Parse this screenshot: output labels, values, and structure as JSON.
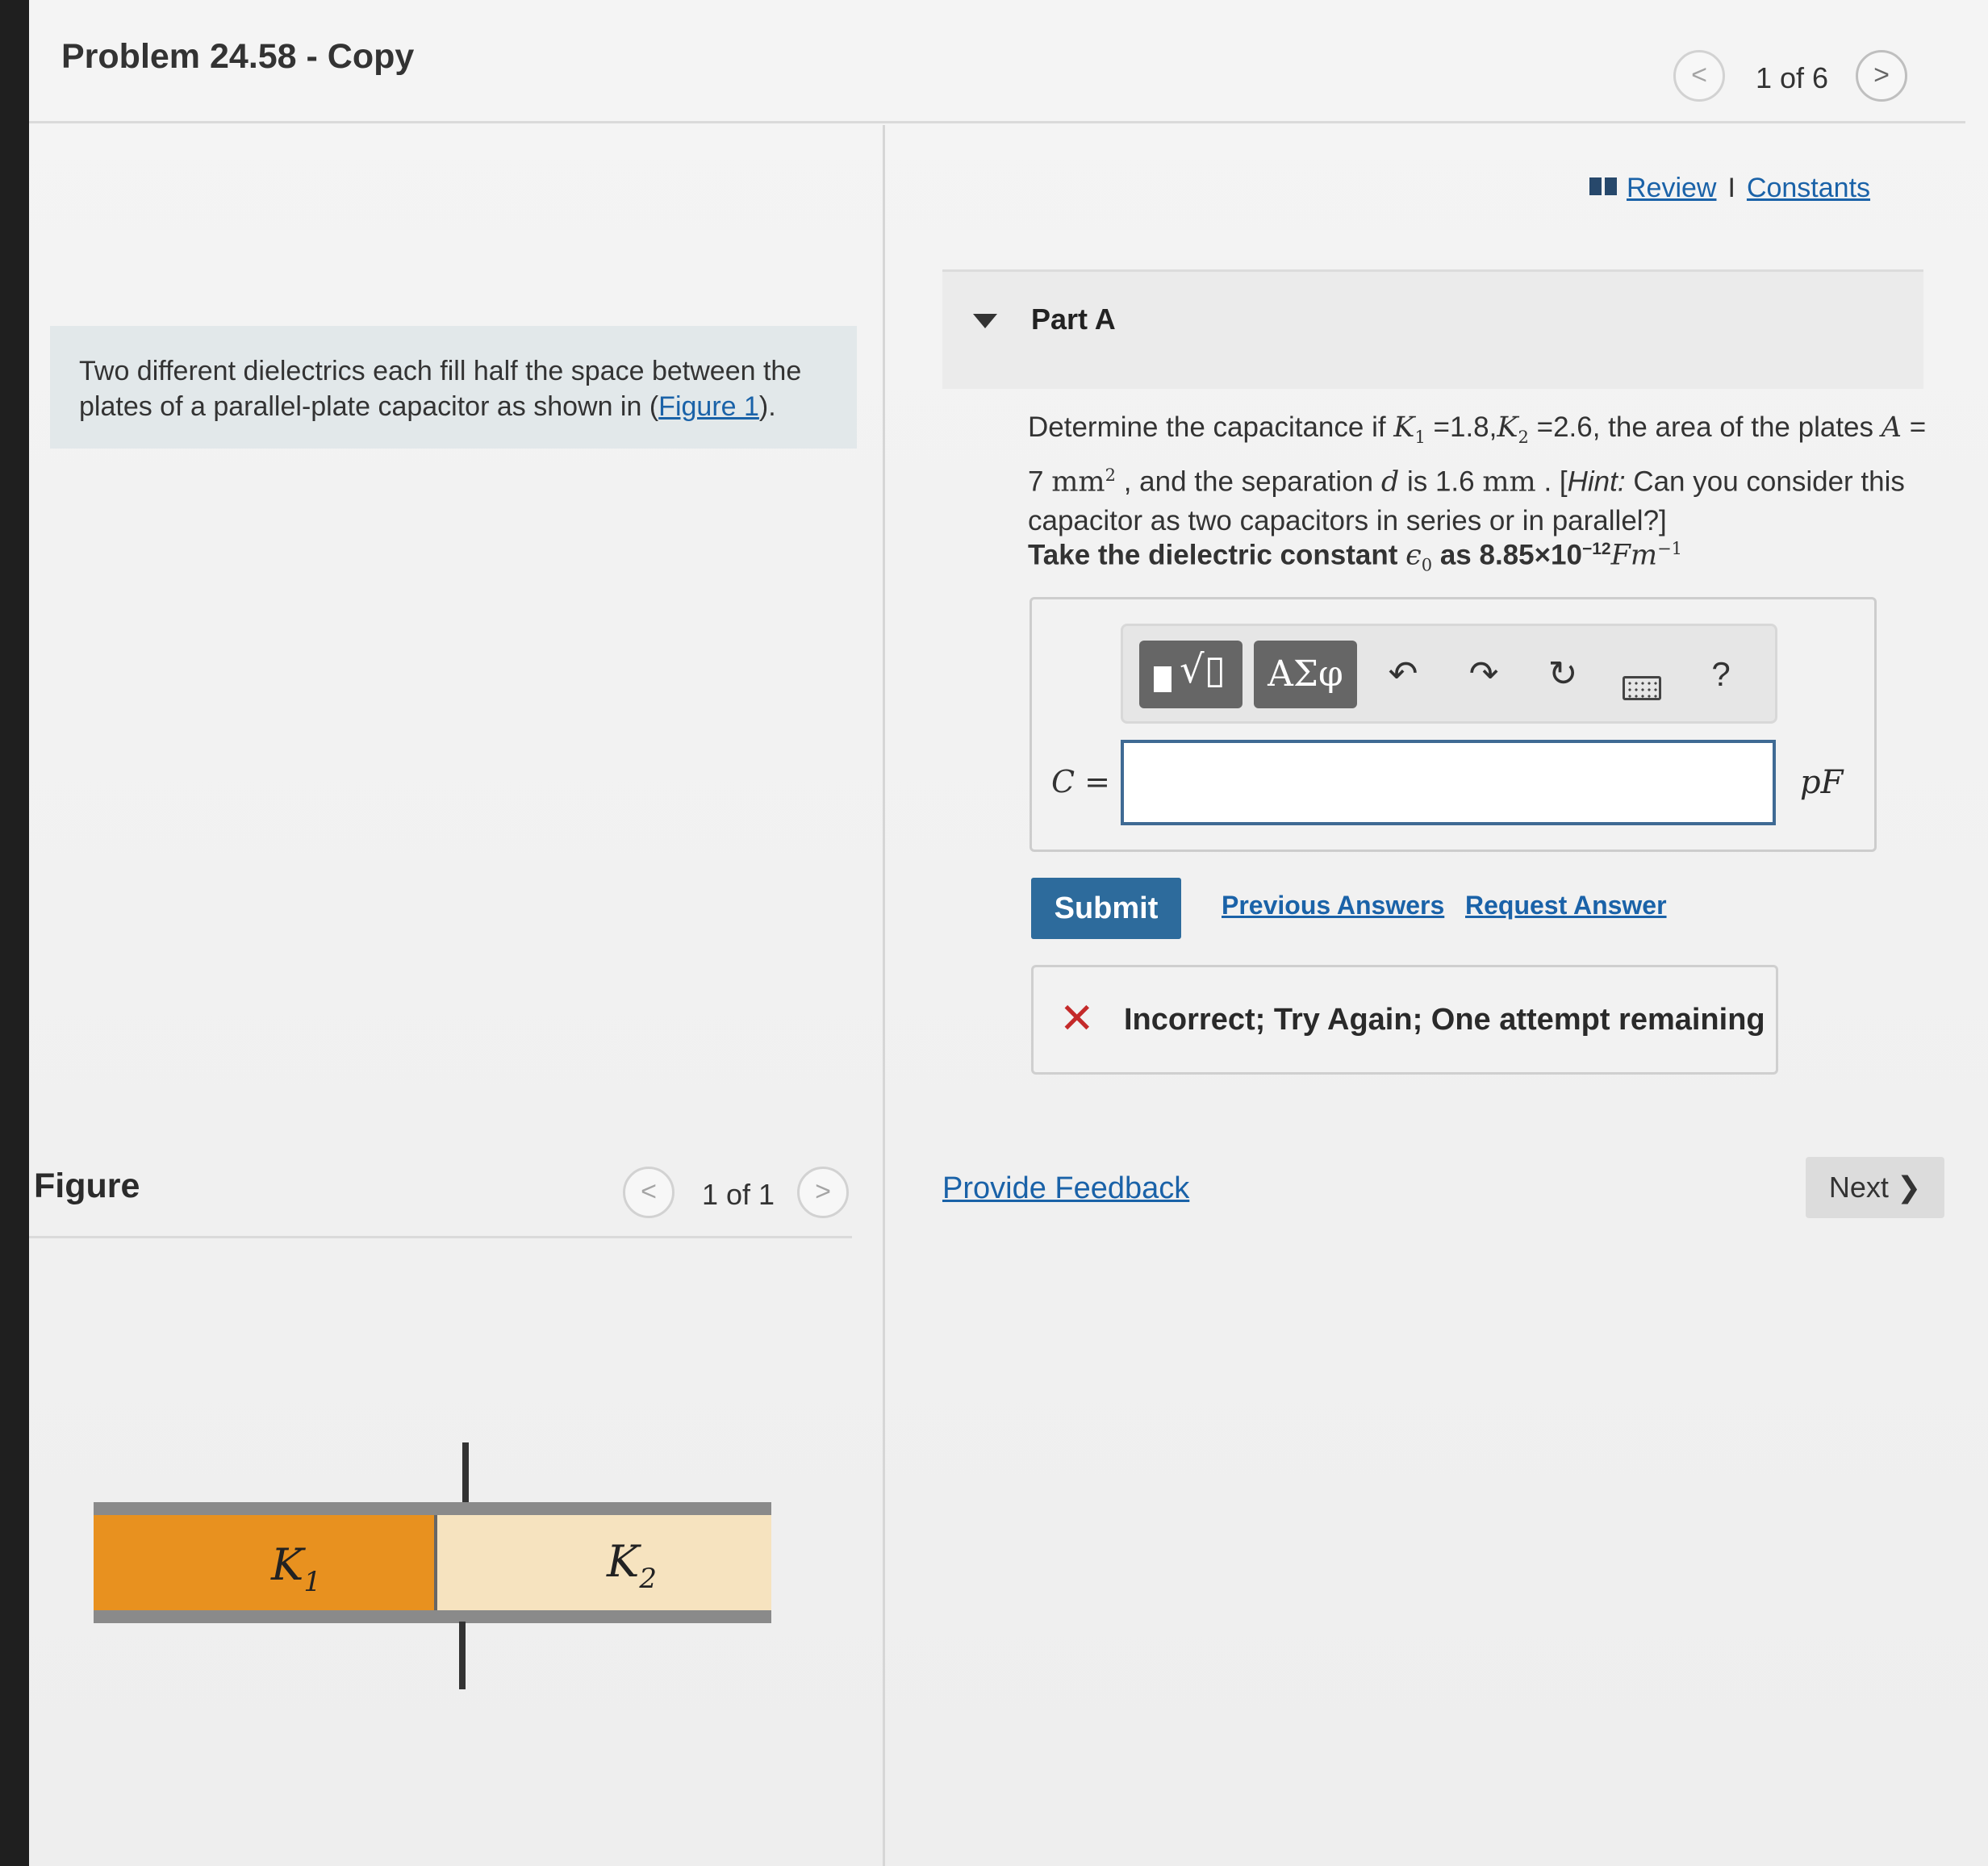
{
  "header": {
    "title": "Problem 24.58 - Copy",
    "counter": "1 of 6",
    "prev_glyph": "<",
    "next_glyph": ">"
  },
  "resources": {
    "review": "Review",
    "separator": "I",
    "constants": "Constants"
  },
  "intro": {
    "text_before": "Two different dielectrics each fill half the space between the plates of a parallel-plate capacitor as shown in (",
    "figure_link": "Figure 1",
    "text_after": ")."
  },
  "part": {
    "title": "Part A",
    "q_determine": "Determine  the capacitance if ",
    "k1_symbol": "K",
    "k1_sub": "1",
    "k1_value": " =1.8,",
    "k2_symbol": "K",
    "k2_sub": "2",
    "k2_value": " =2.6, the area of the plates ",
    "area_symbol": "A",
    "area_eq": " = 7 ",
    "area_unit": "mm",
    "area_exp": "2",
    "q_separation": " , and the separation ",
    "d_symbol": "d",
    "q_is": " is 1.6 ",
    "d_unit": "mm",
    "q_dot": "  . [",
    "hint_label": "Hint:",
    "hint_text": " Can you consider this capacitor as two capacitors in series or in parallel?]",
    "const_prefix": "Take the dielectric constant ",
    "eps_symbol": "ϵ",
    "eps_sub": "0",
    "const_as": "  as 8.85×10",
    "const_exp": "−12",
    "const_unit": "Fm",
    "const_unit_exp": "−1"
  },
  "toolbar": {
    "greek_label": "ΑΣφ",
    "radical_glyph": "√▯",
    "undo_glyph": "↶",
    "redo_glyph": "↷",
    "reset_glyph": "↻",
    "help_label": "?"
  },
  "answer": {
    "label": "C =",
    "value": "",
    "unit": "pF"
  },
  "actions": {
    "submit": "Submit",
    "previous_answers": "Previous Answers",
    "request_answer": "Request Answer"
  },
  "feedback": {
    "icon_glyph": "✕",
    "message": "Incorrect; Try Again; One attempt remaining"
  },
  "footer": {
    "provide_feedback": "Provide Feedback",
    "next": "Next",
    "next_glyph": "❯"
  },
  "figure": {
    "label": "Figure",
    "counter": "1 of 1",
    "k1_label": "K",
    "k1_sub": "1",
    "k2_label": "K",
    "k2_sub": "2"
  },
  "colors": {
    "k1_fill": "#e8911f",
    "k2_fill": "#f6e3bf",
    "accent": "#2d6b9c",
    "link": "#1a62a8",
    "error": "#c42a2a"
  }
}
